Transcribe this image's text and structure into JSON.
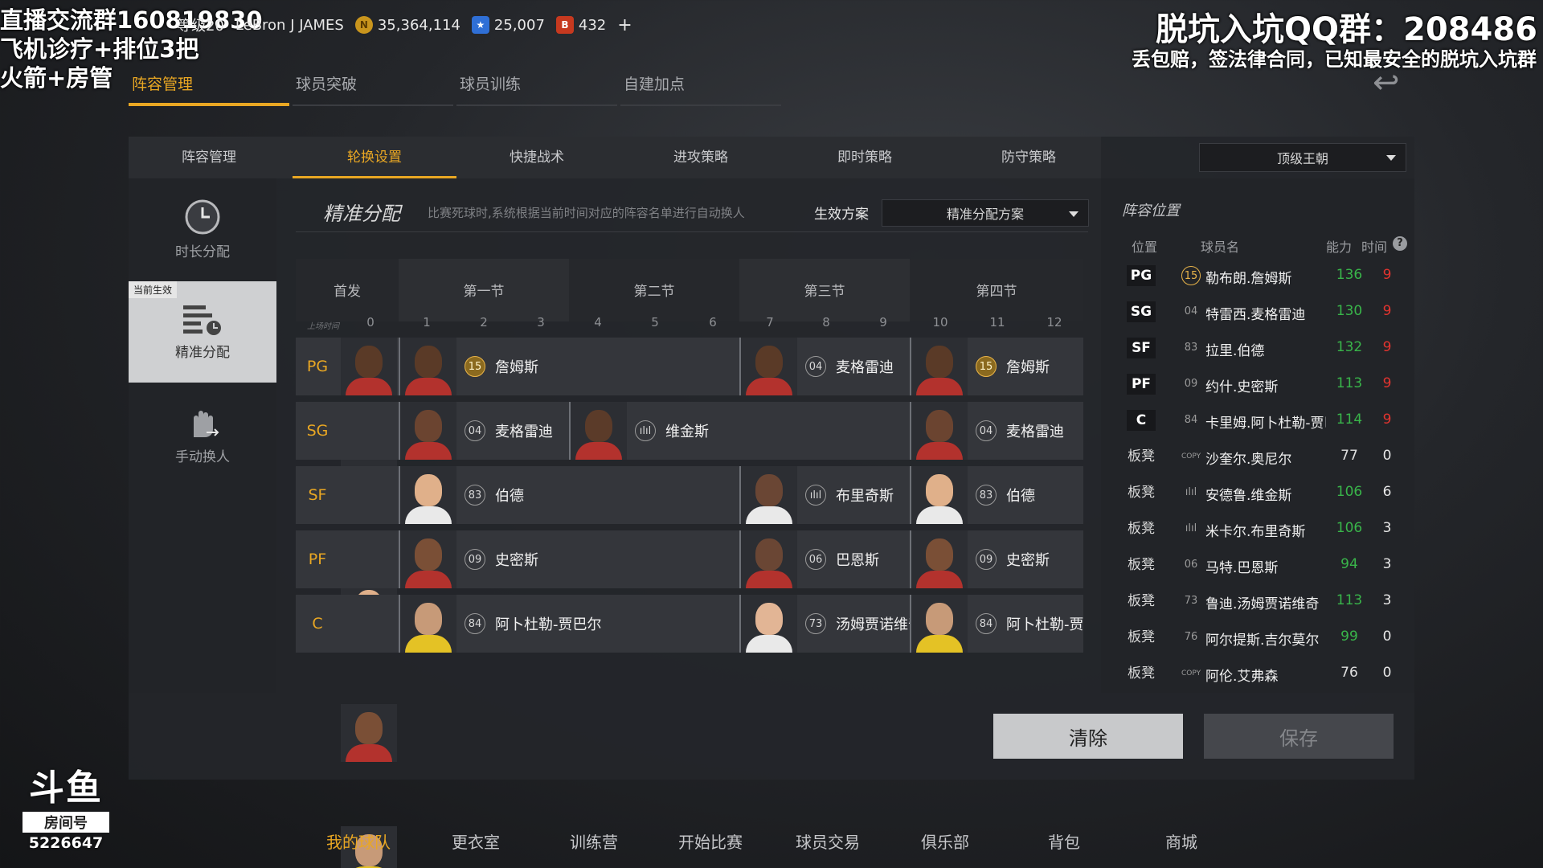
{
  "stream": {
    "line1": "直播交流群160819830",
    "line2": "飞机诊疗+排位3把",
    "line3": "火箭+房管",
    "qq": "脱坑入坑QQ群：208486",
    "promo": "丢包赔，签法律合同，已知最安全的脱坑入坑群",
    "room_label": "房间号",
    "room_number": "5226647"
  },
  "topbar": {
    "level": "等级20",
    "player_name": "LeBron J JAMES",
    "coins": "35,364,114",
    "stars": "25,007",
    "tokens": "432",
    "plus": "+"
  },
  "primary_tabs": [
    "阵容管理",
    "球员突破",
    "球员训练",
    "自建加点"
  ],
  "sub_tabs": [
    "阵容管理",
    "轮换设置",
    "快捷战术",
    "进攻策略",
    "即时策略",
    "防守策略"
  ],
  "difficulty": "顶级王朝",
  "sidenav": {
    "duration": "时长分配",
    "current_badge": "当前生效",
    "precise": "精准分配",
    "manual": "手动换人"
  },
  "lineup": {
    "title": "精准分配",
    "description": "比赛死球时,系统根据当前时间对应的阵容名单进行自动换人",
    "plan_label": "生效方案",
    "plan_value": "精准分配方案",
    "starter_header": "首发",
    "quarters": [
      "第一节",
      "第二节",
      "第三节",
      "第四节"
    ],
    "minutes_label": "上场时间",
    "minutes": [
      "0",
      "1",
      "2",
      "3",
      "4",
      "5",
      "6",
      "7",
      "8",
      "9",
      "10",
      "11",
      "12"
    ],
    "rows": [
      {
        "pos": "PG",
        "segs": [
          {
            "num": "15",
            "name": "詹姆斯",
            "gold": true
          },
          {
            "num": "04",
            "name": "麦格雷迪"
          },
          {
            "num": "15",
            "name": "詹姆斯",
            "gold": true
          }
        ]
      },
      {
        "pos": "SG",
        "segs": [
          {
            "num": "04",
            "name": "麦格雷迪"
          },
          {
            "num": "ılıl",
            "name": "维金斯"
          },
          {
            "num": "04",
            "name": "麦格雷迪"
          }
        ]
      },
      {
        "pos": "SF",
        "segs": [
          {
            "num": "83",
            "name": "伯德"
          },
          {
            "num": "ılıl",
            "name": "布里奇斯"
          },
          {
            "num": "83",
            "name": "伯德"
          }
        ]
      },
      {
        "pos": "PF",
        "segs": [
          {
            "num": "09",
            "name": "史密斯"
          },
          {
            "num": "06",
            "name": "巴恩斯"
          },
          {
            "num": "09",
            "name": "史密斯"
          }
        ]
      },
      {
        "pos": "C",
        "segs": [
          {
            "num": "84",
            "name": "阿卜杜勒-贾巴尔"
          },
          {
            "num": "73",
            "name": "汤姆贾诺维奇"
          },
          {
            "num": "84",
            "name": "阿卜杜勒-贾"
          }
        ]
      }
    ]
  },
  "roster": {
    "title": "阵容位置",
    "headers": {
      "pos": "位置",
      "name": "球员名",
      "ovr": "能力",
      "time": "时间"
    },
    "rows": [
      {
        "pos": "PG",
        "num": "15",
        "name": "勒布朗.詹姆斯",
        "ovr": "136",
        "time": "9"
      },
      {
        "pos": "SG",
        "num": "04",
        "name": "特雷西.麦格雷迪",
        "ovr": "130",
        "time": "9"
      },
      {
        "pos": "SF",
        "num": "83",
        "name": "拉里.伯德",
        "ovr": "132",
        "time": "9"
      },
      {
        "pos": "PF",
        "num": "09",
        "name": "约什.史密斯",
        "ovr": "113",
        "time": "9"
      },
      {
        "pos": "C",
        "num": "84",
        "name": "卡里姆.阿卜杜勒-贾巴尔",
        "ovr": "114",
        "time": "9"
      },
      {
        "pos": "板凳",
        "num": "COPY",
        "name": "沙奎尔.奥尼尔",
        "ovr": "77",
        "time": "0"
      },
      {
        "pos": "板凳",
        "num": "ılıl",
        "name": "安德鲁.维金斯",
        "ovr": "106",
        "time": "6"
      },
      {
        "pos": "板凳",
        "num": "ılıl",
        "name": "米卡尔.布里奇斯",
        "ovr": "106",
        "time": "3"
      },
      {
        "pos": "板凳",
        "num": "06",
        "name": "马特.巴恩斯",
        "ovr": "94",
        "time": "3"
      },
      {
        "pos": "板凳",
        "num": "73",
        "name": "鲁迪.汤姆贾诺维奇",
        "ovr": "113",
        "time": "3"
      },
      {
        "pos": "板凳",
        "num": "76",
        "name": "阿尔提斯.吉尔莫尔",
        "ovr": "99",
        "time": "0"
      },
      {
        "pos": "板凳",
        "num": "COPY",
        "name": "阿伦.艾弗森",
        "ovr": "76",
        "time": "0"
      }
    ]
  },
  "buttons": {
    "clear": "清除",
    "save": "保存"
  },
  "bottom_nav": [
    "我的球队",
    "更衣室",
    "训练营",
    "开始比赛",
    "球员交易",
    "俱乐部",
    "背包",
    "商城"
  ],
  "colors": {
    "accent": "#e9a723",
    "ovr_green": "#39b54a",
    "time_red": "#e3342f"
  },
  "icons": [
    "clock-icon",
    "list-clock-icon",
    "hand-swap-icon",
    "coin-icon",
    "star-icon",
    "token-icon",
    "back-arrow-icon",
    "help-icon",
    "caret-down-icon"
  ]
}
